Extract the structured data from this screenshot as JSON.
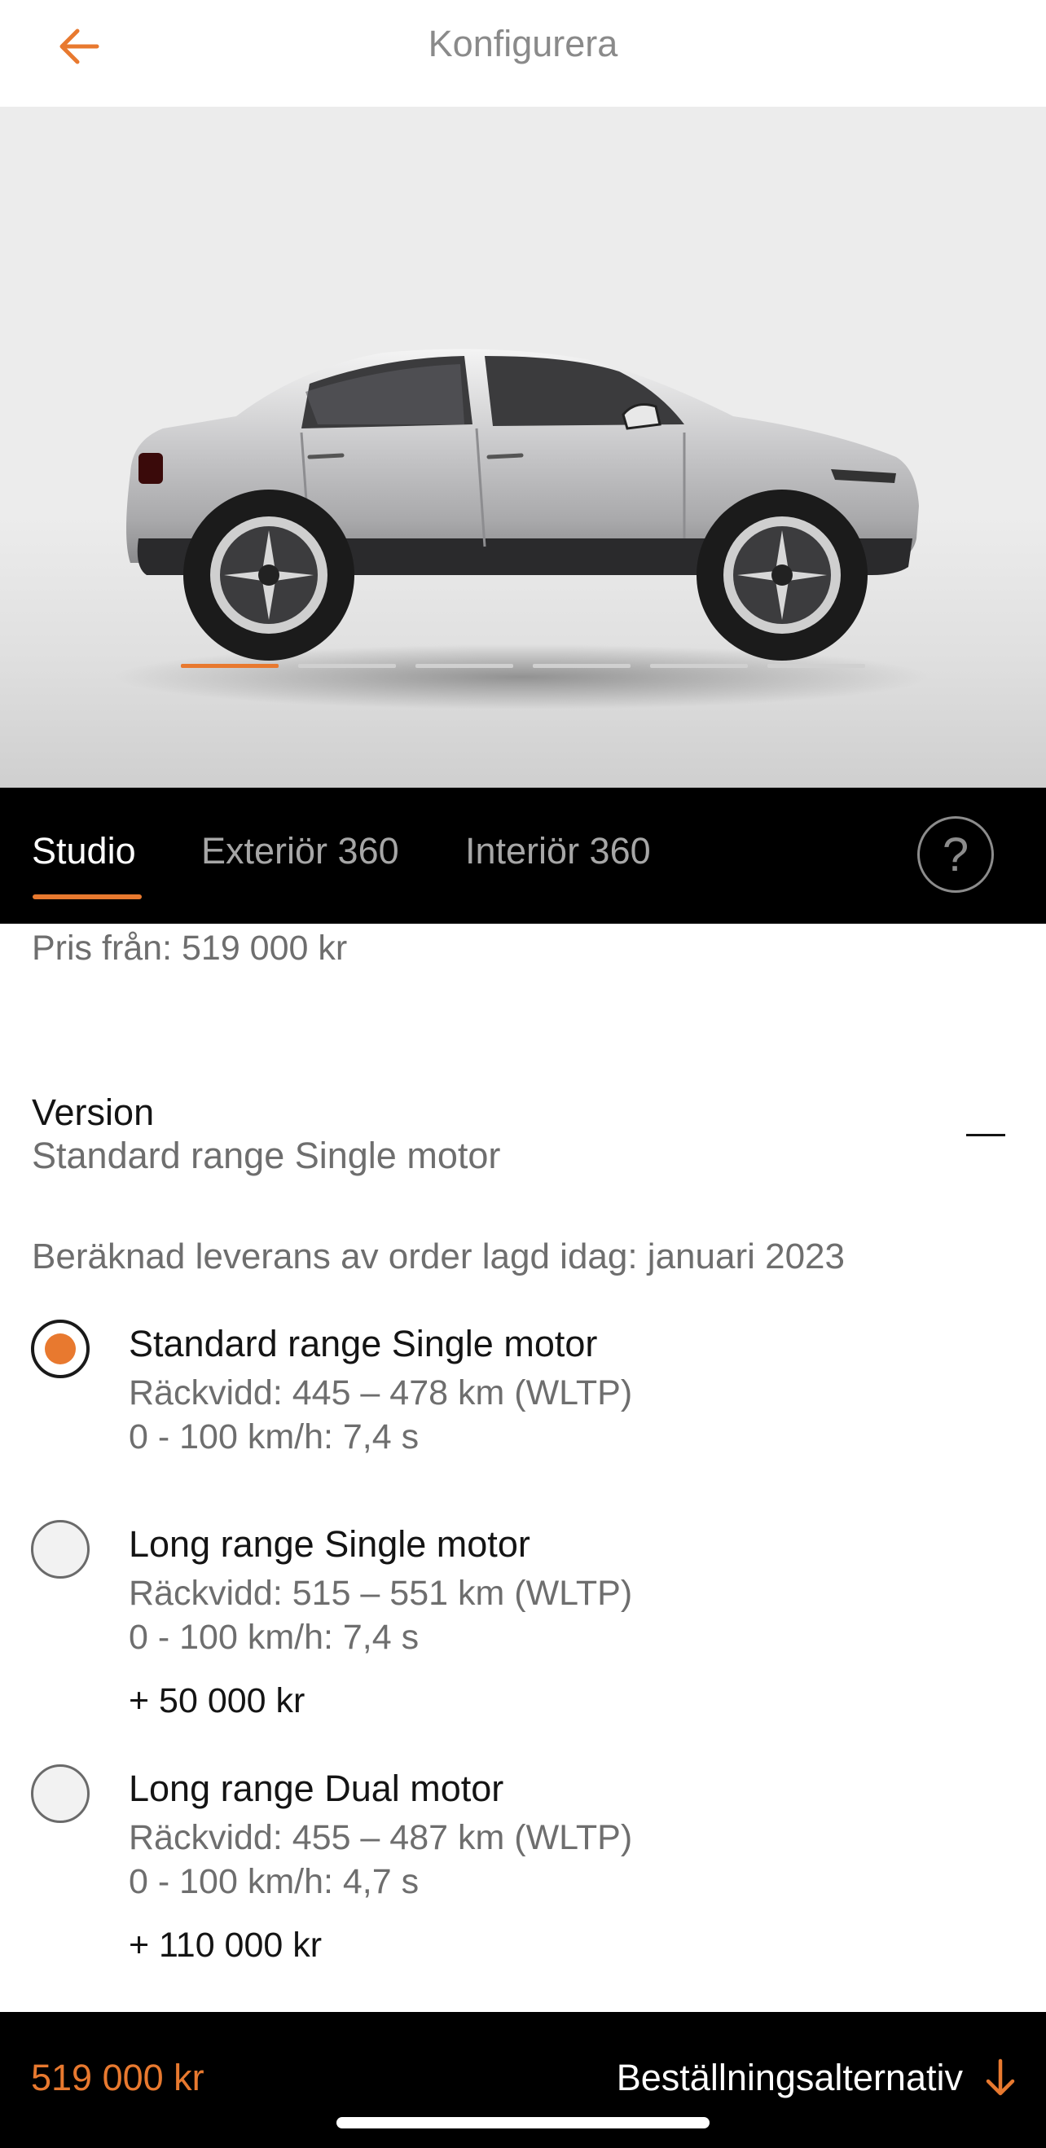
{
  "header": {
    "title": "Konfigurera",
    "back_icon": "arrow-left-icon"
  },
  "hero": {
    "image": "car-side-view",
    "carousel_count": 6,
    "carousel_active_index": 0
  },
  "tabs": {
    "items": [
      {
        "label": "Studio",
        "active": true
      },
      {
        "label": "Exteriör 360",
        "active": false
      },
      {
        "label": "Interiör 360",
        "active": false
      }
    ],
    "help_label": "?"
  },
  "pricing": {
    "price_from": "Pris från: 519 000 kr"
  },
  "version": {
    "label": "Version",
    "selected": "Standard range Single motor",
    "delivery": "Beräknad leverans av order lagd idag: januari 2023",
    "options": [
      {
        "name": "Standard range Single motor",
        "range": "Räckvidd: 445 – 478 km (WLTP)",
        "acceleration": "0 - 100 km/h: 7,4 s",
        "price": "",
        "selected": true
      },
      {
        "name": "Long range Single motor",
        "range": "Räckvidd: 515 – 551 km (WLTP)",
        "acceleration": "0 - 100 km/h: 7,4 s",
        "price": "+ 50 000 kr",
        "selected": false
      },
      {
        "name": "Long range Dual motor",
        "range": "Räckvidd: 455 – 487 km (WLTP)",
        "acceleration": "0 - 100 km/h: 4,7 s",
        "price": "+ 110 000 kr",
        "selected": false
      }
    ]
  },
  "footer": {
    "total": "519 000 kr",
    "order_label": "Beställningsalternativ",
    "order_icon": "arrow-down-icon"
  },
  "colors": {
    "accent": "#e8792f",
    "dark": "#000000",
    "muted_text": "#6e6e6e"
  }
}
